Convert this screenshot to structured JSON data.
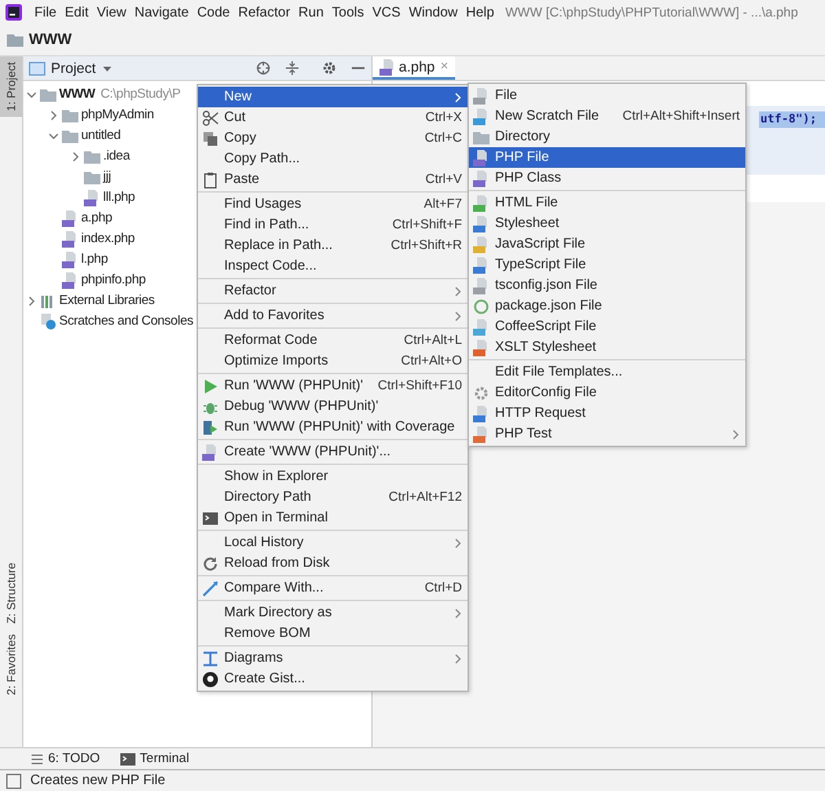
{
  "menu_bar": {
    "items": [
      "File",
      "Edit",
      "View",
      "Navigate",
      "Code",
      "Refactor",
      "Run",
      "Tools",
      "VCS",
      "Window",
      "Help"
    ],
    "title": "WWW [C:\\phpStudy\\PHPTutorial\\WWW] - ...\\a.php"
  },
  "nav_bar": {
    "crumb": "WWW"
  },
  "left_strip": [
    {
      "label": "1: Project",
      "selected": true,
      "kind": "folder"
    },
    {
      "label": "Z: Structure",
      "selected": false,
      "kind": "structure"
    },
    {
      "label": "2: Favorites",
      "selected": false,
      "kind": "star"
    }
  ],
  "project_panel": {
    "title": "Project",
    "tree": [
      {
        "name": "WWW",
        "path": "C:\\phpStudy\\P",
        "kind": "folder",
        "expanded": true,
        "children": [
          {
            "name": "phpMyAdmin",
            "kind": "folder",
            "expanded": false
          },
          {
            "name": "untitled",
            "kind": "folder",
            "expanded": true,
            "children": [
              {
                "name": ".idea",
                "kind": "folder",
                "expanded": false
              },
              {
                "name": "jjj",
                "kind": "folder"
              },
              {
                "name": "lll.php",
                "kind": "php"
              }
            ]
          },
          {
            "name": "a.php",
            "kind": "php"
          },
          {
            "name": "index.php",
            "kind": "php"
          },
          {
            "name": "l.php",
            "kind": "php"
          },
          {
            "name": "phpinfo.php",
            "kind": "php"
          }
        ]
      },
      {
        "name": "External Libraries",
        "kind": "library",
        "expanded": false
      },
      {
        "name": "Scratches and Consoles",
        "kind": "scratch"
      }
    ]
  },
  "editor": {
    "tab": {
      "label": "a.php",
      "close": "×"
    },
    "code_fragment": "utf-8\");"
  },
  "context_menu": [
    [
      {
        "label": "New",
        "submenu": true,
        "selected": true,
        "kind": "none"
      },
      {
        "label": "Cut",
        "shortcut": "Ctrl+X",
        "selected": false,
        "kind": "cut"
      },
      {
        "label": "Copy",
        "shortcut": "Ctrl+C",
        "selected": false,
        "kind": "copy"
      },
      {
        "label": "Copy Path...",
        "selected": false,
        "kind": "none"
      },
      {
        "label": "Paste",
        "shortcut": "Ctrl+V",
        "selected": false,
        "kind": "paste"
      }
    ],
    [
      {
        "label": "Find Usages",
        "shortcut": "Alt+F7",
        "selected": false,
        "kind": "none"
      },
      {
        "label": "Find in Path...",
        "shortcut": "Ctrl+Shift+F",
        "selected": false,
        "kind": "none"
      },
      {
        "label": "Replace in Path...",
        "shortcut": "Ctrl+Shift+R",
        "selected": false,
        "kind": "none"
      },
      {
        "label": "Inspect Code...",
        "selected": false,
        "kind": "none"
      }
    ],
    [
      {
        "label": "Refactor",
        "submenu": true,
        "selected": false,
        "kind": "none"
      }
    ],
    [
      {
        "label": "Add to Favorites",
        "submenu": true,
        "selected": false,
        "kind": "none"
      }
    ],
    [
      {
        "label": "Reformat Code",
        "shortcut": "Ctrl+Alt+L",
        "selected": false,
        "kind": "none"
      },
      {
        "label": "Optimize Imports",
        "shortcut": "Ctrl+Alt+O",
        "selected": false,
        "kind": "none"
      }
    ],
    [
      {
        "label": "Run 'WWW (PHPUnit)'",
        "shortcut": "Ctrl+Shift+F10",
        "selected": false,
        "kind": "run"
      },
      {
        "label": "Debug 'WWW (PHPUnit)'",
        "selected": false,
        "kind": "debug"
      },
      {
        "label": "Run 'WWW (PHPUnit)' with Coverage",
        "selected": false,
        "kind": "coverage"
      }
    ],
    [
      {
        "label": "Create 'WWW (PHPUnit)'...",
        "selected": false,
        "kind": "php"
      }
    ],
    [
      {
        "label": "Show in Explorer",
        "selected": false,
        "kind": "none"
      },
      {
        "label": "Directory Path",
        "shortcut": "Ctrl+Alt+F12",
        "selected": false,
        "kind": "none"
      },
      {
        "label": "Open in Terminal",
        "selected": false,
        "kind": "terminal"
      }
    ],
    [
      {
        "label": "Local History",
        "submenu": true,
        "selected": false,
        "kind": "none"
      },
      {
        "label": "Reload from Disk",
        "selected": false,
        "kind": "reload"
      }
    ],
    [
      {
        "label": "Compare With...",
        "shortcut": "Ctrl+D",
        "selected": false,
        "kind": "compare"
      }
    ],
    [
      {
        "label": "Mark Directory as",
        "submenu": true,
        "selected": false,
        "kind": "none"
      },
      {
        "label": "Remove BOM",
        "selected": false,
        "kind": "none"
      }
    ],
    [
      {
        "label": "Diagrams",
        "submenu": true,
        "selected": false,
        "kind": "diagram"
      },
      {
        "label": "Create Gist...",
        "selected": false,
        "kind": "gist"
      }
    ]
  ],
  "new_submenu": [
    [
      {
        "label": "File",
        "selected": false,
        "kind": "file"
      },
      {
        "label": "New Scratch File",
        "shortcut": "Ctrl+Alt+Shift+Insert",
        "selected": false,
        "kind": "scratch"
      },
      {
        "label": "Directory",
        "selected": false,
        "kind": "folder"
      },
      {
        "label": "PHP File",
        "selected": true,
        "kind": "php"
      },
      {
        "label": "PHP Class",
        "selected": false,
        "kind": "php"
      }
    ],
    [
      {
        "label": "HTML File",
        "selected": false,
        "kind": "html"
      },
      {
        "label": "Stylesheet",
        "selected": false,
        "kind": "css"
      },
      {
        "label": "JavaScript File",
        "selected": false,
        "kind": "js"
      },
      {
        "label": "TypeScript File",
        "selected": false,
        "kind": "ts"
      },
      {
        "label": "tsconfig.json File",
        "selected": false,
        "kind": "json"
      },
      {
        "label": "package.json File",
        "selected": false,
        "kind": "npm"
      },
      {
        "label": "CoffeeScript File",
        "selected": false,
        "kind": "coffee"
      },
      {
        "label": "XSLT Stylesheet",
        "selected": false,
        "kind": "xslt"
      }
    ],
    [
      {
        "label": "Edit File Templates...",
        "selected": false,
        "kind": "none"
      },
      {
        "label": "EditorConfig File",
        "selected": false,
        "kind": "gear"
      },
      {
        "label": "HTTP Request",
        "selected": false,
        "kind": "http"
      },
      {
        "label": "PHP Test",
        "submenu": true,
        "selected": false,
        "kind": "phptest"
      }
    ]
  ],
  "bottom_tools": [
    {
      "label": "6: TODO",
      "kind": "list"
    },
    {
      "label": "Terminal",
      "kind": "terminal"
    }
  ],
  "status_bar": {
    "message": "Creates new PHP File"
  }
}
